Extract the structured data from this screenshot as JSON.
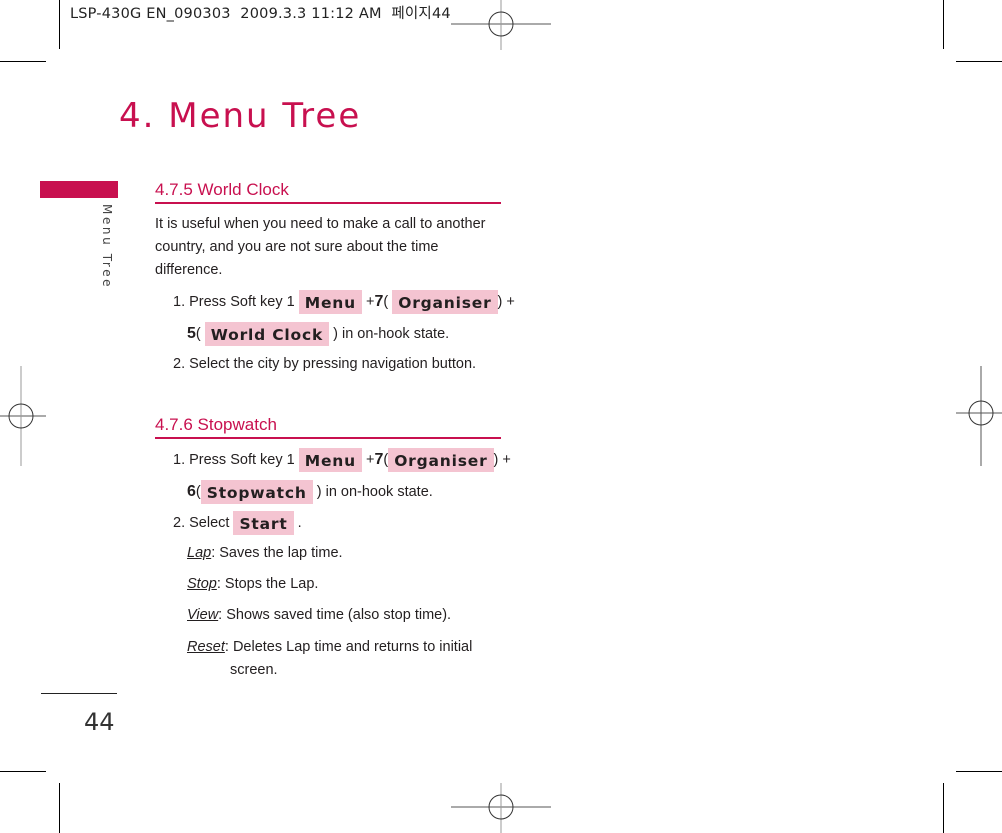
{
  "print_header": {
    "file": "LSP-430G EN_090303",
    "datetime": "2009.3.3 11:12 AM",
    "page_label": "페이지44"
  },
  "chapter_title": "4. Menu Tree",
  "side_label": "Menu Tree",
  "page_number": "44",
  "colors": {
    "accent": "#c8104f",
    "key_highlight": "#f4c4d1",
    "text": "#231f20"
  },
  "sections": [
    {
      "heading": "4.7.5 World Clock",
      "intro": "It is useful when you need to make a call to another country, and you are not sure about the time difference.",
      "steps": [
        {
          "prefix": "1. Press Soft key 1",
          "key1": "Menu",
          "plus1": "+",
          "num1": "7",
          "open1": "(",
          "key2": "Organiser",
          "close1": ")",
          "plus2": "+",
          "num2": "5",
          "open2": "(",
          "key3": "World Clock",
          "close2": ")",
          "suffix": "in on-hook state."
        },
        {
          "text": "2. Select the city by pressing navigation button."
        }
      ]
    },
    {
      "heading": "4.7.6 Stopwatch",
      "steps": [
        {
          "prefix": "1. Press Soft key 1",
          "key1": "Menu",
          "plus1": "+",
          "num1": "7",
          "open1": "(",
          "key2": "Organiser",
          "close1": ")",
          "plus2": "+",
          "num2": "6",
          "open2": "(",
          "key3": "Stopwatch",
          "close2": ")",
          "suffix": "in on-hook state."
        },
        {
          "prefix": "2. Select",
          "key": "Start",
          "suffix": "."
        }
      ],
      "definitions": [
        {
          "term": "Lap",
          "desc": ": Saves the lap time."
        },
        {
          "term": "Stop",
          "desc": ": Stops the Lap."
        },
        {
          "term": "View",
          "desc": ": Shows saved time (also stop time)."
        },
        {
          "term": "Reset",
          "desc": ": Deletes Lap time and returns to initial",
          "desc_cont": "screen."
        }
      ]
    }
  ]
}
